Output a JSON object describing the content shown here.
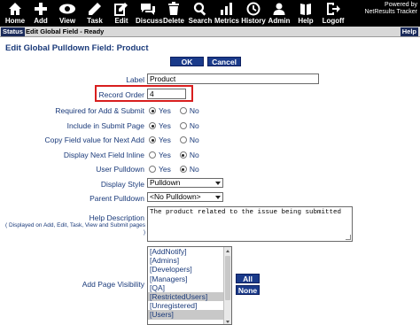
{
  "toolbar": {
    "items": [
      {
        "label": "Home",
        "icon": "home-icon"
      },
      {
        "label": "Add",
        "icon": "plus-icon"
      },
      {
        "label": "View",
        "icon": "eye-icon"
      },
      {
        "label": "Task",
        "icon": "pencil-icon"
      },
      {
        "label": "Edit",
        "icon": "edit-icon"
      },
      {
        "label": "Discuss",
        "icon": "chat-icon"
      },
      {
        "label": "Delete",
        "icon": "trash-icon"
      },
      {
        "label": "Search",
        "icon": "search-icon"
      },
      {
        "label": "Metrics",
        "icon": "chart-icon"
      },
      {
        "label": "History",
        "icon": "clock-icon"
      },
      {
        "label": "Admin",
        "icon": "user-icon"
      },
      {
        "label": "Help",
        "icon": "book-icon"
      },
      {
        "label": "Logoff",
        "icon": "logoff-icon"
      }
    ],
    "powered_line1": "Powered by",
    "powered_line2": "NetResults Tracker"
  },
  "status": {
    "tab": "Status",
    "text": "Edit Global Field - Ready",
    "help": "Help"
  },
  "page": {
    "title": "Edit Global Pulldown Field: Product",
    "ok_label": "OK",
    "cancel_label": "Cancel"
  },
  "form": {
    "label": {
      "label": "Label",
      "value": "Product"
    },
    "record_order": {
      "label": "Record Order",
      "value": "4"
    },
    "required": {
      "label": "Required for Add & Submit",
      "yes": "Yes",
      "no": "No",
      "selected": "yes"
    },
    "include_submit": {
      "label": "Include in Submit Page",
      "yes": "Yes",
      "no": "No",
      "selected": "yes"
    },
    "copy_field": {
      "label": "Copy Field value for Next Add",
      "yes": "Yes",
      "no": "No",
      "selected": "yes"
    },
    "display_next": {
      "label": "Display Next Field Inline",
      "yes": "Yes",
      "no": "No",
      "selected": "no"
    },
    "user_pulldown": {
      "label": "User Pulldown",
      "yes": "Yes",
      "no": "No",
      "selected": "no"
    },
    "display_style": {
      "label": "Display Style",
      "value": "Pulldown"
    },
    "parent_pulldown": {
      "label": "Parent Pulldown",
      "value": "<No Pulldown>"
    },
    "help_description": {
      "label": "Help Description",
      "sub": "( Displayed on Add, Edit, Task, View and Submit pages )",
      "value": "The product related to the issue being submitted"
    },
    "add_page_visibility": {
      "label": "Add Page Visibility",
      "options": [
        {
          "text": "[AddNotify]",
          "selected": false
        },
        {
          "text": "[Admins]",
          "selected": false
        },
        {
          "text": "[Developers]",
          "selected": false
        },
        {
          "text": "[Managers]",
          "selected": false
        },
        {
          "text": "[QA]",
          "selected": false
        },
        {
          "text": "[RestrictedUsers]",
          "selected": true
        },
        {
          "text": "[Unregistered]",
          "selected": false
        },
        {
          "text": "[Users]",
          "selected": true
        }
      ],
      "all_label": "All",
      "none_label": "None"
    }
  },
  "colors": {
    "toolbar_bg": "#000000",
    "label_text": "#1a3a7a",
    "button_bg": "#1a3a8a",
    "highlight": "#d81e1e"
  }
}
